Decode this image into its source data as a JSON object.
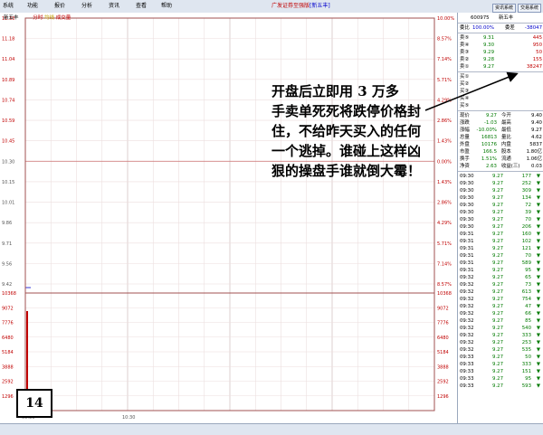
{
  "menu": [
    "系统",
    "功能",
    "报价",
    "分析",
    "资讯",
    "查看",
    "帮助"
  ],
  "app_title": "广发证券至强版",
  "app_title_tag": "[新五丰]",
  "top_buttons": [
    "资讯系统",
    "交易系统"
  ],
  "chart": {
    "stock_name": "新五丰",
    "legend_a": "分时",
    "legend_b": "均线",
    "legend_c": "成交量",
    "price_labels": [
      "11.33",
      "11.18",
      "11.04",
      "10.89",
      "10.74",
      "10.59",
      "10.45",
      "10.30",
      "10.15",
      "10.01",
      "9.86",
      "9.71",
      "9.56",
      "9.42"
    ],
    "pct_labels": [
      "10.00%",
      "8.57%",
      "7.14%",
      "5.71%",
      "4.29%",
      "2.86%",
      "1.43%",
      "0.00%",
      "1.43%",
      "2.86%",
      "4.29%",
      "5.71%",
      "7.14%",
      "8.57%"
    ],
    "vol_labels": [
      "10368",
      "9072",
      "7776",
      "6480",
      "5184",
      "3888",
      "2592",
      "1296"
    ],
    "x_labels": [
      "09:30",
      "10:30"
    ]
  },
  "panel": {
    "code": "600975",
    "name": "新五丰",
    "ratio_label": "委比",
    "ratio_value": "100.00%",
    "diff_label": "委差",
    "diff_value": "-38047",
    "sell": [
      {
        "label": "卖⑤",
        "price": "9.31",
        "vol": "445"
      },
      {
        "label": "卖④",
        "price": "9.30",
        "vol": "950"
      },
      {
        "label": "卖③",
        "price": "9.29",
        "vol": "50"
      },
      {
        "label": "卖②",
        "price": "9.28",
        "vol": "155"
      },
      {
        "label": "卖①",
        "price": "9.27",
        "vol": "38247"
      }
    ],
    "buy": [
      {
        "label": "买①"
      },
      {
        "label": "买②"
      },
      {
        "label": "买③"
      },
      {
        "label": "买④"
      },
      {
        "label": "买⑤"
      }
    ],
    "stats": [
      {
        "a": "现价",
        "b": "9.27",
        "c": "今开",
        "d": "9.40"
      },
      {
        "a": "涨跌",
        "b": "-1.03",
        "c": "最高",
        "d": "9.40"
      },
      {
        "a": "涨幅",
        "b": "-10.00%",
        "c": "最低",
        "d": "9.27"
      },
      {
        "a": "总量",
        "b": "16813",
        "c": "量比",
        "d": "4.62"
      },
      {
        "a": "外盘",
        "b": "10176",
        "c": "内盘",
        "d": "5837"
      },
      {
        "a": "市盈",
        "b": "166.5",
        "c": "股本",
        "d": "1.80亿"
      },
      {
        "a": "换手",
        "b": "1.51%",
        "c": "流通",
        "d": "1.06亿"
      },
      {
        "a": "净资",
        "b": "2.63",
        "c": "收益(三)",
        "d": "0.03"
      }
    ],
    "ticks": [
      {
        "t": "09:30",
        "p": "9.27",
        "v": "177"
      },
      {
        "t": "09:30",
        "p": "9.27",
        "v": "252"
      },
      {
        "t": "09:30",
        "p": "9.27",
        "v": "309"
      },
      {
        "t": "09:30",
        "p": "9.27",
        "v": "134"
      },
      {
        "t": "09:30",
        "p": "9.27",
        "v": "72"
      },
      {
        "t": "09:30",
        "p": "9.27",
        "v": "39"
      },
      {
        "t": "09:30",
        "p": "9.27",
        "v": "70"
      },
      {
        "t": "09:30",
        "p": "9.27",
        "v": "206"
      },
      {
        "t": "09:31",
        "p": "9.27",
        "v": "160"
      },
      {
        "t": "09:31",
        "p": "9.27",
        "v": "102"
      },
      {
        "t": "09:31",
        "p": "9.27",
        "v": "121"
      },
      {
        "t": "09:31",
        "p": "9.27",
        "v": "70"
      },
      {
        "t": "09:31",
        "p": "9.27",
        "v": "589"
      },
      {
        "t": "09:31",
        "p": "9.27",
        "v": "95"
      },
      {
        "t": "09:32",
        "p": "9.27",
        "v": "65"
      },
      {
        "t": "09:32",
        "p": "9.27",
        "v": "73"
      },
      {
        "t": "09:32",
        "p": "9.27",
        "v": "613"
      },
      {
        "t": "09:32",
        "p": "9.27",
        "v": "754"
      },
      {
        "t": "09:32",
        "p": "9.27",
        "v": "47"
      },
      {
        "t": "09:32",
        "p": "9.27",
        "v": "66"
      },
      {
        "t": "09:32",
        "p": "9.27",
        "v": "85"
      },
      {
        "t": "09:32",
        "p": "9.27",
        "v": "540"
      },
      {
        "t": "09:32",
        "p": "9.27",
        "v": "333"
      },
      {
        "t": "09:32",
        "p": "9.27",
        "v": "253"
      },
      {
        "t": "09:32",
        "p": "9.27",
        "v": "535"
      },
      {
        "t": "09:33",
        "p": "9.27",
        "v": "50"
      },
      {
        "t": "09:33",
        "p": "9.27",
        "v": "333"
      },
      {
        "t": "09:33",
        "p": "9.27",
        "v": "151"
      },
      {
        "t": "09:33",
        "p": "9.27",
        "v": "95"
      },
      {
        "t": "09:33",
        "p": "9.27",
        "v": "593"
      }
    ]
  },
  "annotation": {
    "lines": [
      "开盘后立即用 3 万多",
      "手卖单死死将跌停价格封",
      "住，不给昨天买入的任何",
      "一个逃掉。谁碰上这样凶",
      "狠的操盘手谁就倒大霉！"
    ]
  },
  "badge": "14"
}
